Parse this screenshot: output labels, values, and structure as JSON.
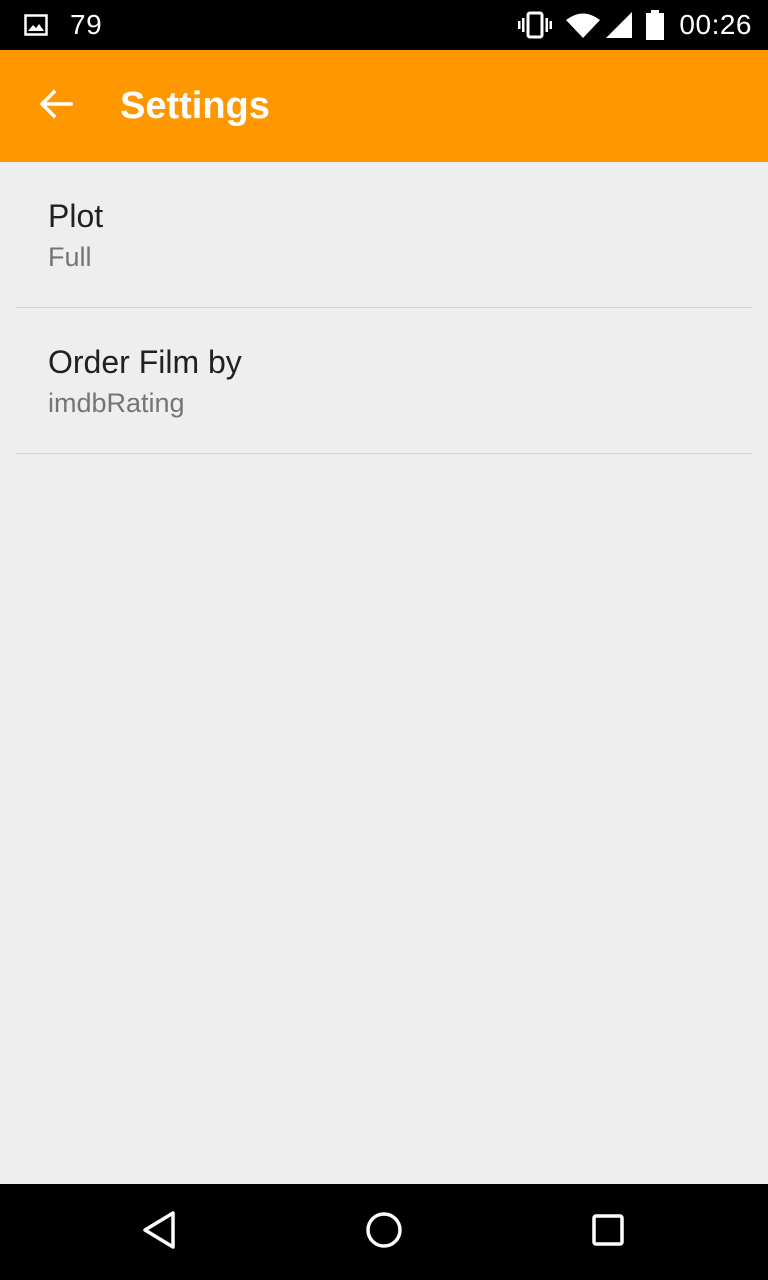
{
  "status_bar": {
    "notification_icon": "image-icon",
    "notification_count": "79",
    "icons": [
      "vibrate-icon",
      "wifi-icon",
      "signal-icon",
      "battery-icon"
    ],
    "time": "00:26"
  },
  "app_bar": {
    "back_icon": "arrow-left-icon",
    "title": "Settings",
    "color": "#ff9800"
  },
  "preferences": [
    {
      "title": "Plot",
      "summary": "Full"
    },
    {
      "title": "Order Film by",
      "summary": "imdbRating"
    }
  ],
  "nav_bar": {
    "buttons": [
      "back-triangle-icon",
      "home-circle-icon",
      "recents-square-icon"
    ]
  }
}
